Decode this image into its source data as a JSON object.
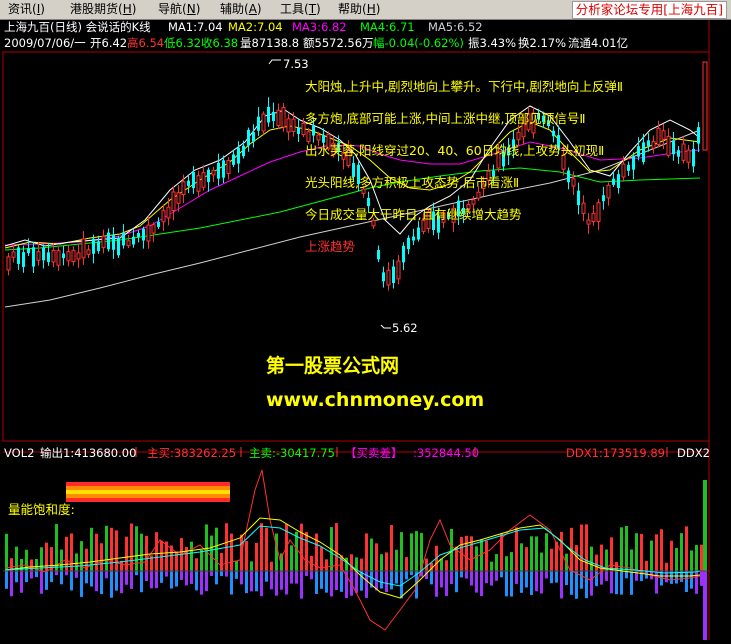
{
  "menu": {
    "items": [
      "资讯",
      "港股期货",
      "导航",
      "辅助",
      "工具",
      "帮助"
    ],
    "hotkeys": [
      "I",
      "H",
      "N",
      "A",
      "T",
      "H"
    ],
    "forum_badge": "分析家论坛专用[上海九百]"
  },
  "header": {
    "title": "上海九百(日线) 会说话的K线",
    "ma1": "MA1:7.04",
    "ma2": "MA2:7.04",
    "ma3": "MA3:6.82",
    "ma4": "MA4:6.71",
    "ma5": "MA5:6.52",
    "date": "2009/07/06/一",
    "open": "开6.42",
    "high": "高6.54",
    "low": "低6.32",
    "close": "收6.38",
    "volume": "量87138.8",
    "amount": "额5572.56万",
    "change": "幅-0.04(-0.62%)",
    "amplitude": "振3.43%",
    "turnover": "换2.17%",
    "float": "流通4.01亿"
  },
  "annotations": {
    "high_price": "7.53",
    "low_price": "5.62",
    "lines": [
      "大阳烛,上升中,剧烈地向上攀升。下行中,剧烈地向上反弹Ⅱ",
      "多方炮,底部可能上涨,中间上涨中继,顶部见顶信号Ⅱ",
      "出水芙蓉,阳线穿过20、40、60日均线,上攻势头初现Ⅱ",
      "光头阳线,多方积极上攻态势,后市看涨Ⅱ",
      "今日成交量大于昨日,且有继续增大趋势",
      "上涨趋势"
    ]
  },
  "watermark": {
    "line1": "第一股票公式网",
    "line2": "www.chnmoney.com"
  },
  "indicator": {
    "name": "VOL2",
    "output1": "输出1:413680.00",
    "main_buy": "主买:383262.25",
    "main_sell": "主卖:-30417.75",
    "buy_sell_diff_label": "【买卖差】",
    "buy_sell_diff_value": ":352844.50",
    "ddx1": "DDX1:173519.89",
    "ddx2": "DDX2",
    "saturation_label": "量能饱和度:"
  },
  "colors": {
    "up": "#ff3232",
    "down": "#00ffff",
    "ma1": "#ffffff",
    "ma2": "#ffff00",
    "ma3": "#ff00ff",
    "ma4": "#00ff00",
    "ma5": "#d0d0d0",
    "annotation": "#ffff00",
    "trend": "#ff3232",
    "watermark1": "#ffff00",
    "watermark2": "#ffff00",
    "pos_bar": "#ff3232",
    "neg_bar": "#1e90ff",
    "neg_bar2": "#9b30ff",
    "green_bar": "#1fbf1f"
  }
}
